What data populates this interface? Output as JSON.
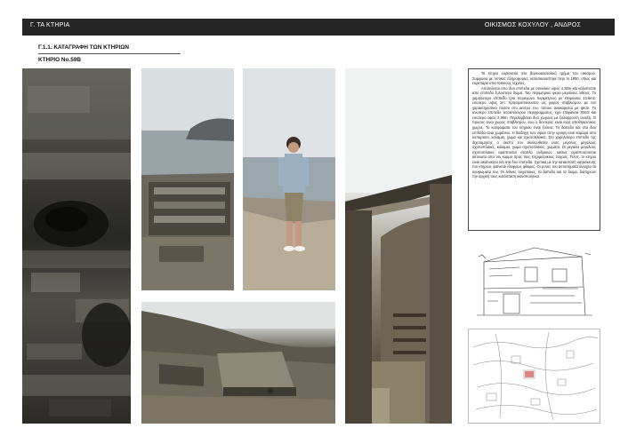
{
  "header": {
    "section": "Γ. ΤΑ ΚΤΗΡΙΑ",
    "project": "ΟΙΚΙΣΜΟΣ ΚΟΧΥΛΟΥ , ΑΝΔΡΟΣ"
  },
  "section_title": "Γ.1.1. ΚΑΤΑΓΡΑΦΗ ΤΩΝ ΚΤΗΡΙΩΝ",
  "building_title": "ΚΤΗΡΙΟ Νο.59Β",
  "description": [
    "Το κτηριο ευρισκεται στο βορειοανατολικό τμήμα του οικισμού. Συμφωνα με τοπικες πληροφοριες, κατασκευαστηκε περι το 1850, οπως και ευρεπαρα απο τοπικους τεχνίτες.",
    "Αποτελειται απο δυο επιπεδα με συνολικο υψος 4,35m και καλυπτεται απο επιπεδο ξυλοστεγο δωμα. Του περιμετρικο φερει μεγαλους λιθους. Το χαμηλοτερο επιπεδο (για τετραγωνο περιμετρου) με επιφανεια 13,8m2, εσωτερο υψος 2m. Χρησιμοποιουνταν ως χωρος σταβλισμου, με τον χαρακτηριστικο πεσσο στο κεντρο του, τοποιο ανακαρειται με ψευτι. Το ανωτερο επιπεδο τετραπλευρου περιγραμματος, εχει επιφανεια 30m2 και εσωτερο υψος 2,90m. Περιλαμβανει δυο χωρους με ξυλοφρουτη ανοιξη. Ο πρωτος ειναι χωρος σταβλισμου, ενω ο δευτερος ειναι ενας αποθηκευτικος χωρος. Το κουφωματα του κτηριου ειναι ξυλινα. Το δαπεδο και στα δυο επιπεδα ειναι χωμάτινο. Η διαδοχη των υψων στην οροφη ειναι καμαρα απο κυπαρισσι, καλαμια, χωμα και σχιστοπλακες. Στο χαμηλοτερο επιπεδο της διχοτομησης ο σκεπο του ακολουθειται ενας μεγαλος μεγαλους σχιστοπλακες, καλαμια, χωμα σχιστοπλακες, χωματα. Οι μεγαλοι μεγαλους σχιστοπλακες εφαπτονται σταπλο ανδρικων, καθως αναπτυσσονται ακτινωτα απο τον κορμο προς τους περιμετρικους τοιχους. Τελος, το κτηριο ειναι ακατοικητο και στα δυο επιπεδα. Σχετικα με την καταστασή κατασκευής του κτηριου, φαινεται ελαφρως φθορες. Οι μονες του αντιστήματα ανοιχτα τα κουφωματα του. Οι λιθινες τοιχοποιιες, τα δαπεδο και τα δωμα, διατηρουν την αρχική τους κατάσταση ικανοποιητικα."
  ],
  "photos": [
    "stone-wall-detail-photo",
    "ruined-building-sea-view-photo",
    "person-standing-on-roof-photo",
    "hillside-building-overview-photo",
    "interior-wooden-door-photo"
  ]
}
